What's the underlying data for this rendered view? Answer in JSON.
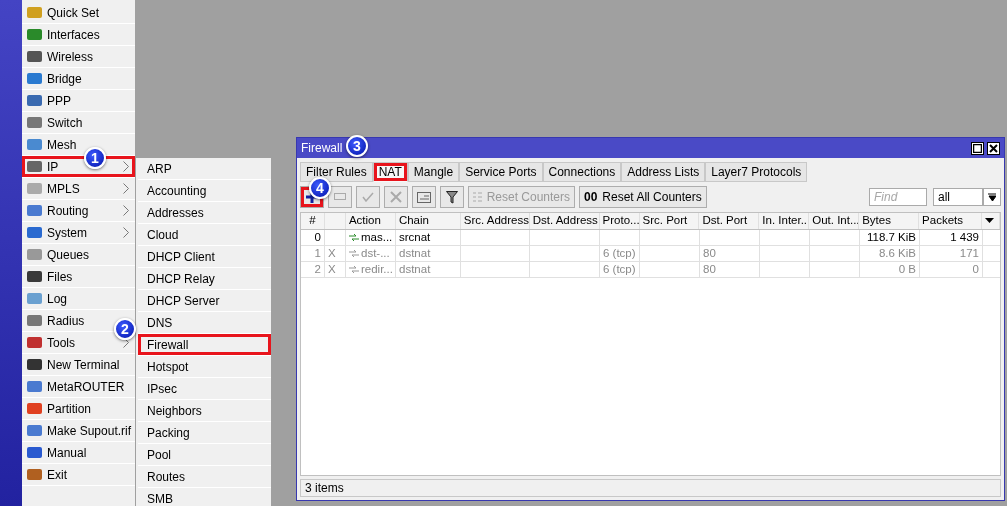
{
  "main_menu": [
    {
      "label": "Quick Set",
      "has_submenu": false,
      "highlighted": false
    },
    {
      "label": "Interfaces",
      "has_submenu": false,
      "highlighted": false
    },
    {
      "label": "Wireless",
      "has_submenu": false,
      "highlighted": false
    },
    {
      "label": "Bridge",
      "has_submenu": false,
      "highlighted": false
    },
    {
      "label": "PPP",
      "has_submenu": false,
      "highlighted": false
    },
    {
      "label": "Switch",
      "has_submenu": false,
      "highlighted": false
    },
    {
      "label": "Mesh",
      "has_submenu": false,
      "highlighted": false
    },
    {
      "label": "IP",
      "has_submenu": true,
      "highlighted": true,
      "callout": "1"
    },
    {
      "label": "MPLS",
      "has_submenu": true,
      "highlighted": false
    },
    {
      "label": "Routing",
      "has_submenu": true,
      "highlighted": false
    },
    {
      "label": "System",
      "has_submenu": true,
      "highlighted": false
    },
    {
      "label": "Queues",
      "has_submenu": false,
      "highlighted": false
    },
    {
      "label": "Files",
      "has_submenu": false,
      "highlighted": false
    },
    {
      "label": "Log",
      "has_submenu": false,
      "highlighted": false
    },
    {
      "label": "Radius",
      "has_submenu": false,
      "highlighted": false
    },
    {
      "label": "Tools",
      "has_submenu": true,
      "highlighted": false
    },
    {
      "label": "New Terminal",
      "has_submenu": false,
      "highlighted": false
    },
    {
      "label": "MetaROUTER",
      "has_submenu": false,
      "highlighted": false
    },
    {
      "label": "Partition",
      "has_submenu": false,
      "highlighted": false
    },
    {
      "label": "Make Supout.rif",
      "has_submenu": false,
      "highlighted": false
    },
    {
      "label": "Manual",
      "has_submenu": false,
      "highlighted": false
    },
    {
      "label": "Exit",
      "has_submenu": false,
      "highlighted": false
    }
  ],
  "ip_submenu": [
    {
      "label": "ARP",
      "highlighted": false
    },
    {
      "label": "Accounting",
      "highlighted": false
    },
    {
      "label": "Addresses",
      "highlighted": false
    },
    {
      "label": "Cloud",
      "highlighted": false
    },
    {
      "label": "DHCP Client",
      "highlighted": false
    },
    {
      "label": "DHCP Relay",
      "highlighted": false
    },
    {
      "label": "DHCP Server",
      "highlighted": false
    },
    {
      "label": "DNS",
      "highlighted": false
    },
    {
      "label": "Firewall",
      "highlighted": true,
      "callout": "2"
    },
    {
      "label": "Hotspot",
      "highlighted": false
    },
    {
      "label": "IPsec",
      "highlighted": false
    },
    {
      "label": "Neighbors",
      "highlighted": false
    },
    {
      "label": "Packing",
      "highlighted": false
    },
    {
      "label": "Pool",
      "highlighted": false
    },
    {
      "label": "Routes",
      "highlighted": false
    },
    {
      "label": "SMB",
      "highlighted": false
    }
  ],
  "window": {
    "title": "Firewall",
    "tabs": [
      {
        "label": "Filter Rules",
        "selected": false,
        "highlighted": false
      },
      {
        "label": "NAT",
        "selected": true,
        "highlighted": true,
        "callout": "3"
      },
      {
        "label": "Mangle",
        "selected": false,
        "highlighted": false
      },
      {
        "label": "Service Ports",
        "selected": false,
        "highlighted": false
      },
      {
        "label": "Connections",
        "selected": false,
        "highlighted": false
      },
      {
        "label": "Address Lists",
        "selected": false,
        "highlighted": false
      },
      {
        "label": "Layer7 Protocols",
        "selected": false,
        "highlighted": false
      }
    ],
    "toolbar": {
      "add": {
        "highlighted": true,
        "callout": "4"
      },
      "reset_counters": "Reset Counters",
      "reset_all_counters_icon": "00",
      "reset_all_counters": "Reset All Counters",
      "find_placeholder": "Find",
      "filter_value": "all"
    },
    "table": {
      "columns": [
        "#",
        "",
        "Action",
        "Chain",
        "Src. Address",
        "Dst. Address",
        "Proto...",
        "Src. Port",
        "Dst. Port",
        "In. Inter...",
        "Out. Int...",
        "Bytes",
        "Packets"
      ],
      "rows": [
        {
          "number": "0",
          "disabled": false,
          "action": "mas...",
          "chain": "srcnat",
          "protocol": "",
          "dst_port": "",
          "bytes": "118.7 KiB",
          "packets": "1 439"
        },
        {
          "number": "1",
          "disabled": true,
          "flag": "X",
          "action": "dst-...",
          "chain": "dstnat",
          "protocol": "6 (tcp)",
          "dst_port": "80",
          "bytes": "8.6 KiB",
          "packets": "171"
        },
        {
          "number": "2",
          "disabled": true,
          "flag": "X",
          "action": "redir...",
          "chain": "dstnat",
          "protocol": "6 (tcp)",
          "dst_port": "80",
          "bytes": "0 B",
          "packets": "0"
        }
      ]
    },
    "status": "3 items"
  }
}
